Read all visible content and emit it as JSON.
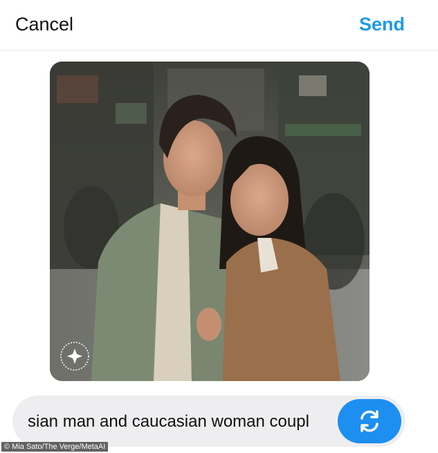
{
  "header": {
    "cancel_label": "Cancel",
    "send_label": "Send"
  },
  "image": {
    "watermark_icon": "meta-ai-imagined-badge-icon",
    "colors": {
      "background": "#4a4b44",
      "jacket_green": "#7d8a73",
      "coat_brown": "#9a6f4c"
    }
  },
  "composer": {
    "prompt_value": "sian man and caucasian woman coupl",
    "regenerate_icon": "refresh-arrows-icon",
    "accent": "#1c8ff0"
  },
  "credit": "© Mia Sato/The Verge/MetaAI"
}
